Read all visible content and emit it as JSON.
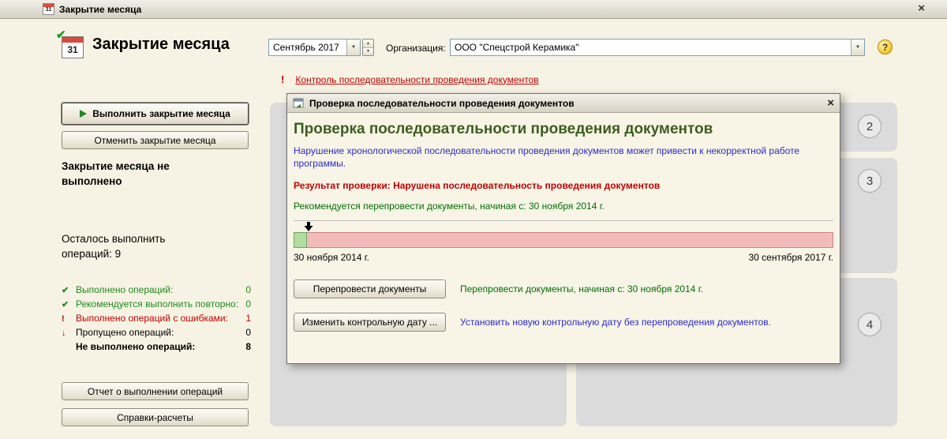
{
  "colors": {
    "accent_red": "#C00000",
    "accent_green": "#007000",
    "accent_blue": "#2B2BC8",
    "heading_green": "#3C5E1E",
    "timeline_green": "#B2DCA4",
    "timeline_pink": "#F4BBBB"
  },
  "icons": {
    "dropdown": "▼",
    "spinner_up": "▲",
    "spinner_down": "▼",
    "help": "?",
    "close": "×",
    "check": "✔",
    "error": "!",
    "skipped": "↓",
    "warning": "!",
    "calendar_day": "31"
  },
  "window": {
    "title": "Закрытие месяца"
  },
  "header": {
    "title": "Закрытие месяца",
    "period_value": "Сентябрь 2017",
    "organization_label": "Организация:",
    "organization_value": "ООО \"Спецстрой Керамика\""
  },
  "warning": {
    "link": "Контроль последовательности проведения документов"
  },
  "sidebar": {
    "run_button": "Выполнить закрытие месяца",
    "cancel_button": "Отменить закрытие месяца",
    "status_text": "Закрытие месяца не выполнено",
    "remaining_text": "Осталось выполнить операций: 9",
    "stats": [
      {
        "glyph": "✔",
        "label": "Выполнено операций:",
        "value": "0"
      },
      {
        "glyph": "✔",
        "label": "Рекомендуется выполнить повторно:",
        "value": "0"
      },
      {
        "glyph": "!",
        "label": "Выполнено операций с ошибками:",
        "value": "1"
      },
      {
        "glyph": "↓",
        "label": "Пропущено операций:",
        "value": "0"
      },
      {
        "glyph": "",
        "label": "Не выполнено операций:",
        "value": "8"
      }
    ],
    "report_button": "Отчет о выполнении операций",
    "references_button": "Справки-расчеты"
  },
  "stages": {
    "stage2": "2",
    "stage3": "3",
    "stage4": "4"
  },
  "dialog": {
    "title": "Проверка последовательности проведения документов",
    "heading": "Проверка последовательности проведения документов",
    "description": "Нарушение хронологической последовательности проведения документов может привести к некорректной работе программы.",
    "result": "Результат проверки: Нарушена последовательность проведения документов",
    "recommendation": "Рекомендуется перепровести документы, начиная с: 30 ноября 2014 г.",
    "timeline": {
      "start": "30 ноября 2014 г.",
      "end": "30 сентября 2017 г."
    },
    "repost_button": "Перепровести документы",
    "repost_hint": "Перепровести документы, начиная с: 30 ноября 2014 г.",
    "change_date_button": "Изменить контрольную дату ...",
    "change_date_hint": "Установить новую контрольную дату без перепроведения документов."
  }
}
